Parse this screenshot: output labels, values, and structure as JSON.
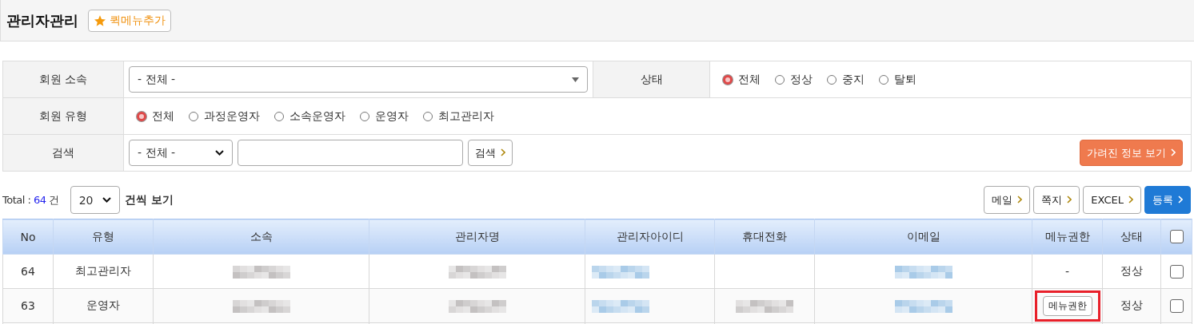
{
  "page_title": "관리자관리",
  "quick_menu_button": "퀵메뉴추가",
  "filters": {
    "affiliation": {
      "label": "회원 소속",
      "value": "- 전체 -"
    },
    "status": {
      "label": "상태",
      "options": [
        {
          "label": "전체",
          "selected": true
        },
        {
          "label": "정상",
          "selected": false
        },
        {
          "label": "중지",
          "selected": false
        },
        {
          "label": "탈퇴",
          "selected": false
        }
      ]
    },
    "member_type": {
      "label": "회원 유형",
      "options": [
        {
          "label": "전체",
          "selected": true
        },
        {
          "label": "과정운영자",
          "selected": false
        },
        {
          "label": "소속운영자",
          "selected": false
        },
        {
          "label": "운영자",
          "selected": false
        },
        {
          "label": "최고관리자",
          "selected": false
        }
      ]
    },
    "search": {
      "label": "검색",
      "scope": "- 전체 -",
      "button": "검색",
      "hidden_info_button": "가려진 정보 보기"
    }
  },
  "summary": {
    "total_label": "Total : ",
    "total": "64",
    "unit": "건",
    "page_size": "20",
    "page_size_suffix": "건씩 보기"
  },
  "actions": [
    {
      "label": "메일",
      "kind": "plain"
    },
    {
      "label": "쪽지",
      "kind": "plain"
    },
    {
      "label": "EXCEL",
      "kind": "plain"
    },
    {
      "label": "등록",
      "kind": "primary"
    }
  ],
  "table": {
    "columns": [
      "No",
      "유형",
      "소속",
      "관리자명",
      "관리자아이디",
      "휴대전화",
      "이메일",
      "메뉴권한",
      "상태"
    ],
    "header_checked": false,
    "rows": [
      {
        "no": "64",
        "type": "최고관리자",
        "affiliation": {
          "kind": "blurred",
          "color": "#c4c1c1"
        },
        "name": {
          "kind": "blurred",
          "color": "#c4c1c1"
        },
        "id": {
          "kind": "blurred",
          "color": "#a9cbe8"
        },
        "phone": null,
        "email": {
          "kind": "blurred",
          "color": "#a9cbe8"
        },
        "menu": {
          "kind": "text",
          "text": "-",
          "highlighted": false
        },
        "status": "정상",
        "checked": false
      },
      {
        "no": "63",
        "type": "운영자",
        "affiliation": {
          "kind": "blurred",
          "color": "#c4c1c1"
        },
        "name": {
          "kind": "blurred",
          "color": "#c4c1c1"
        },
        "id": {
          "kind": "blurred",
          "color": "#a9cbe8"
        },
        "phone": {
          "kind": "blurred",
          "color": "#c4c1c1"
        },
        "email": {
          "kind": "blurred",
          "color": "#a9cbe8"
        },
        "menu": {
          "kind": "button",
          "text": "메뉴권한",
          "highlighted": true
        },
        "status": "정상",
        "checked": false
      }
    ]
  }
}
